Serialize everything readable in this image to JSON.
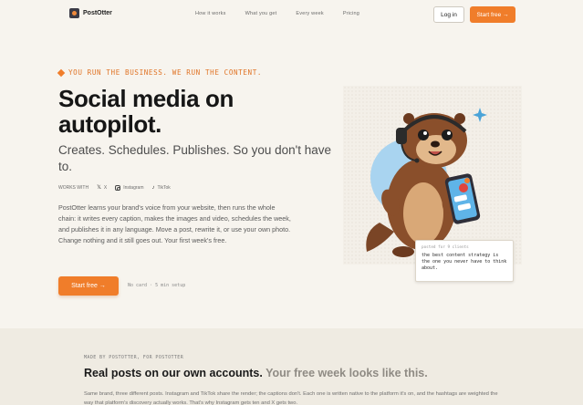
{
  "nav": {
    "brand": "PostOtter",
    "links": [
      "How it works",
      "What you get",
      "Every week",
      "Pricing"
    ],
    "login_label": "Log in",
    "start_label": "Start free →"
  },
  "hero": {
    "eyebrow": "YOU RUN THE BUSINESS. WE RUN THE CONTENT.",
    "headline": "Social media on autopilot.",
    "subhead": "Creates. Schedules. Publishes. So you don't have to.",
    "social_label": "WORKS WITH",
    "social": [
      {
        "icon": "x-icon",
        "glyph": "𝕏",
        "label": "X"
      },
      {
        "icon": "instagram-icon",
        "label": "Instagram"
      },
      {
        "icon": "tiktok-icon",
        "glyph": "♪",
        "label": "TikTok"
      }
    ],
    "body": "PostOtter learns your brand's voice from your website, then runs the whole chain: it writes every caption, makes the images and video, schedules the week, and publishes it in any language. Move a post, rewrite it, or use your own photo. Change nothing and it still goes out. Your first week's free.",
    "cta_label": "Start free →",
    "cta_note": "No card · 5 min setup"
  },
  "illustration": {
    "caption_label": "posted for 9 clients",
    "caption_text": "the best content strategy is the one you never have to think about."
  },
  "section2": {
    "eyebrow": "MADE BY POSTOTTER, FOR POSTOTTER",
    "title_main": "Real posts on our own accounts.",
    "title_muted": "Your free week looks like this.",
    "body": "Same brand, three different posts. Instagram and TikTok share the render; the captions don't. Each one is written native to the platform it's on, and the hashtags are weighted the way that platform's discovery actually works. That's why Instagram gets ten and X gets two."
  },
  "colors": {
    "accent": "#f07d2a",
    "background": "#f7f4ee",
    "section_bg": "#efebe2"
  }
}
